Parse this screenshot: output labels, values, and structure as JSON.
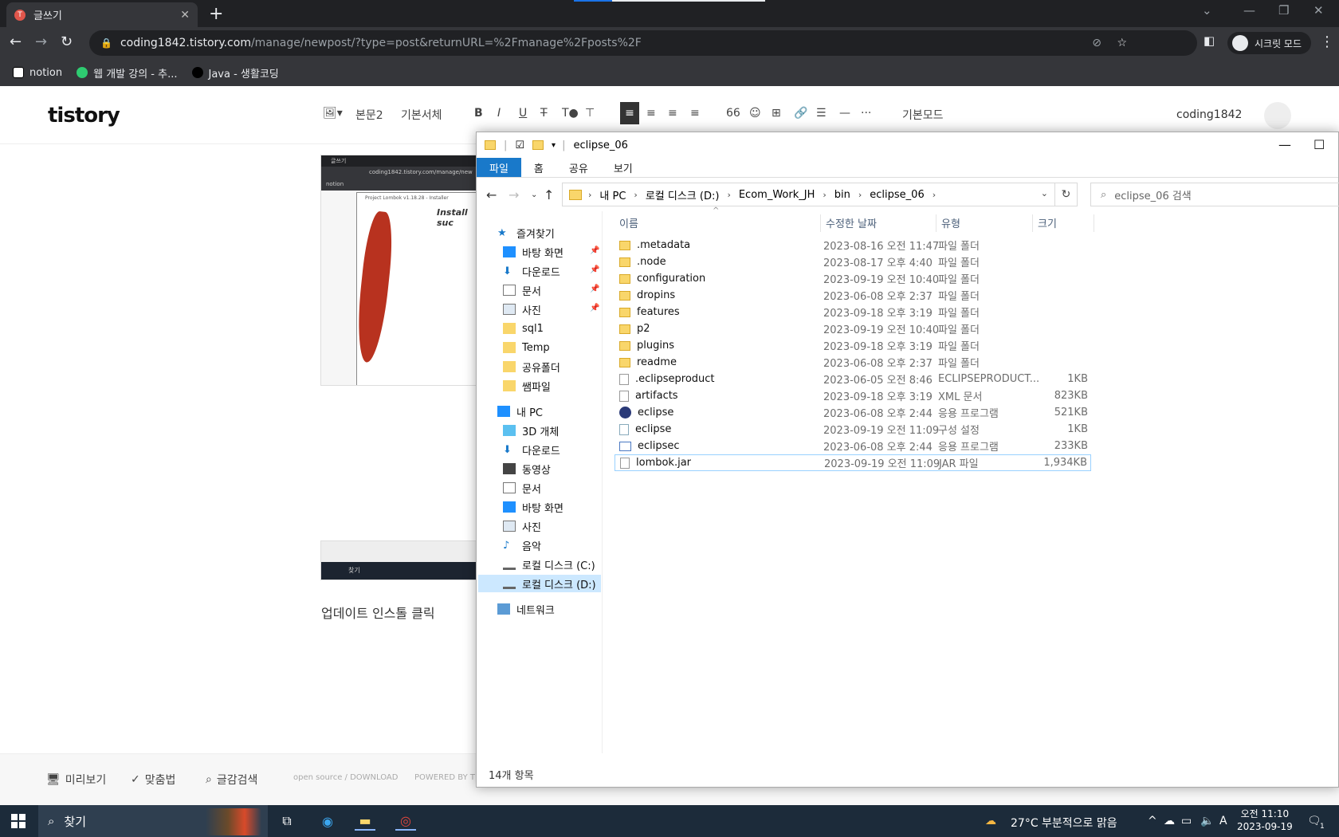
{
  "browser": {
    "tab_title": "글쓰기",
    "tab_favicon": "T",
    "url_host": "coding1842.tistory.com",
    "url_path": "/manage/newpost/?type=post&returnURL=%2Fmanage%2Fposts%2F",
    "incognito_label": "시크릿 모드",
    "bookmarks": [
      {
        "label": "notion"
      },
      {
        "label": "웹 개발 강의 - 추..."
      },
      {
        "label": "Java - 생활코딩"
      }
    ]
  },
  "editor": {
    "logo": "tistory",
    "toolbar": {
      "paragraph": "본문2",
      "font": "기본서체",
      "mode": "기본모드"
    },
    "username": "coding1842",
    "caption": "업데이트 인스톨 클릭",
    "footer": {
      "preview": "미리보기",
      "spellcheck": "맞춤법",
      "search": "글감검색",
      "opensource": "open source / DOWNLOAD",
      "powered": "POWERED BY TINY"
    },
    "thumb_installer_heading": "Install suc",
    "thumb_tab": "글쓰기",
    "thumb_url": "coding1842.tistory.com/manage/new",
    "thumb_bookmark": "notion",
    "thumb_window": "Project Lombok v1.18.28 - Installer",
    "thumb_search": "찾기"
  },
  "explorer": {
    "window_title": "eclipse_06",
    "ribbon_tabs": [
      "파일",
      "홈",
      "공유",
      "보기"
    ],
    "breadcrumb": [
      "내 PC",
      "로컬 디스크 (D:)",
      "Ecom_Work_JH",
      "bin",
      "eclipse_06"
    ],
    "search_placeholder": "eclipse_06 검색",
    "columns": {
      "name": "이름",
      "date": "수정한 날짜",
      "type": "유형",
      "size": "크기"
    },
    "nav": {
      "quick_access": "즐겨찾기",
      "qa_items": [
        "바탕 화면",
        "다운로드",
        "문서",
        "사진",
        "sql1",
        "Temp",
        "공유폴더",
        "쌤파일"
      ],
      "this_pc": "내 PC",
      "pc_items": [
        "3D 개체",
        "다운로드",
        "동영상",
        "문서",
        "바탕 화면",
        "사진",
        "음악",
        "로컬 디스크 (C:)",
        "로컬 디스크 (D:)"
      ],
      "network": "네트워크"
    },
    "files": [
      {
        "name": ".metadata",
        "date": "2023-08-16 오전 11:47",
        "type": "파일 폴더",
        "size": "",
        "icon": "folder"
      },
      {
        "name": ".node",
        "date": "2023-08-17 오후 4:40",
        "type": "파일 폴더",
        "size": "",
        "icon": "folder"
      },
      {
        "name": "configuration",
        "date": "2023-09-19 오전 10:40",
        "type": "파일 폴더",
        "size": "",
        "icon": "folder"
      },
      {
        "name": "dropins",
        "date": "2023-06-08 오후 2:37",
        "type": "파일 폴더",
        "size": "",
        "icon": "folder"
      },
      {
        "name": "features",
        "date": "2023-09-18 오후 3:19",
        "type": "파일 폴더",
        "size": "",
        "icon": "folder"
      },
      {
        "name": "p2",
        "date": "2023-09-19 오전 10:40",
        "type": "파일 폴더",
        "size": "",
        "icon": "folder"
      },
      {
        "name": "plugins",
        "date": "2023-09-18 오후 3:19",
        "type": "파일 폴더",
        "size": "",
        "icon": "folder"
      },
      {
        "name": "readme",
        "date": "2023-06-08 오후 2:37",
        "type": "파일 폴더",
        "size": "",
        "icon": "folder"
      },
      {
        "name": ".eclipseproduct",
        "date": "2023-06-05 오전 8:46",
        "type": "ECLIPSEPRODUCT...",
        "size": "1KB",
        "icon": "file"
      },
      {
        "name": "artifacts",
        "date": "2023-09-18 오후 3:19",
        "type": "XML 문서",
        "size": "823KB",
        "icon": "file"
      },
      {
        "name": "eclipse",
        "date": "2023-06-08 오후 2:44",
        "type": "응용 프로그램",
        "size": "521KB",
        "icon": "app"
      },
      {
        "name": "eclipse",
        "date": "2023-09-19 오전 11:09",
        "type": "구성 설정",
        "size": "1KB",
        "icon": "cfg"
      },
      {
        "name": "eclipsec",
        "date": "2023-06-08 오후 2:44",
        "type": "응용 프로그램",
        "size": "233KB",
        "icon": "win"
      },
      {
        "name": "lombok.jar",
        "date": "2023-09-19 오전 11:09",
        "type": "JAR 파일",
        "size": "1,934KB",
        "icon": "file"
      }
    ],
    "status": "14개 항목"
  },
  "taskbar": {
    "search": "찾기",
    "weather": "27°C  부분적으로 맑음",
    "ime": "A",
    "time": "오전 11:10",
    "date": "2023-09-19",
    "notifications": "1"
  }
}
